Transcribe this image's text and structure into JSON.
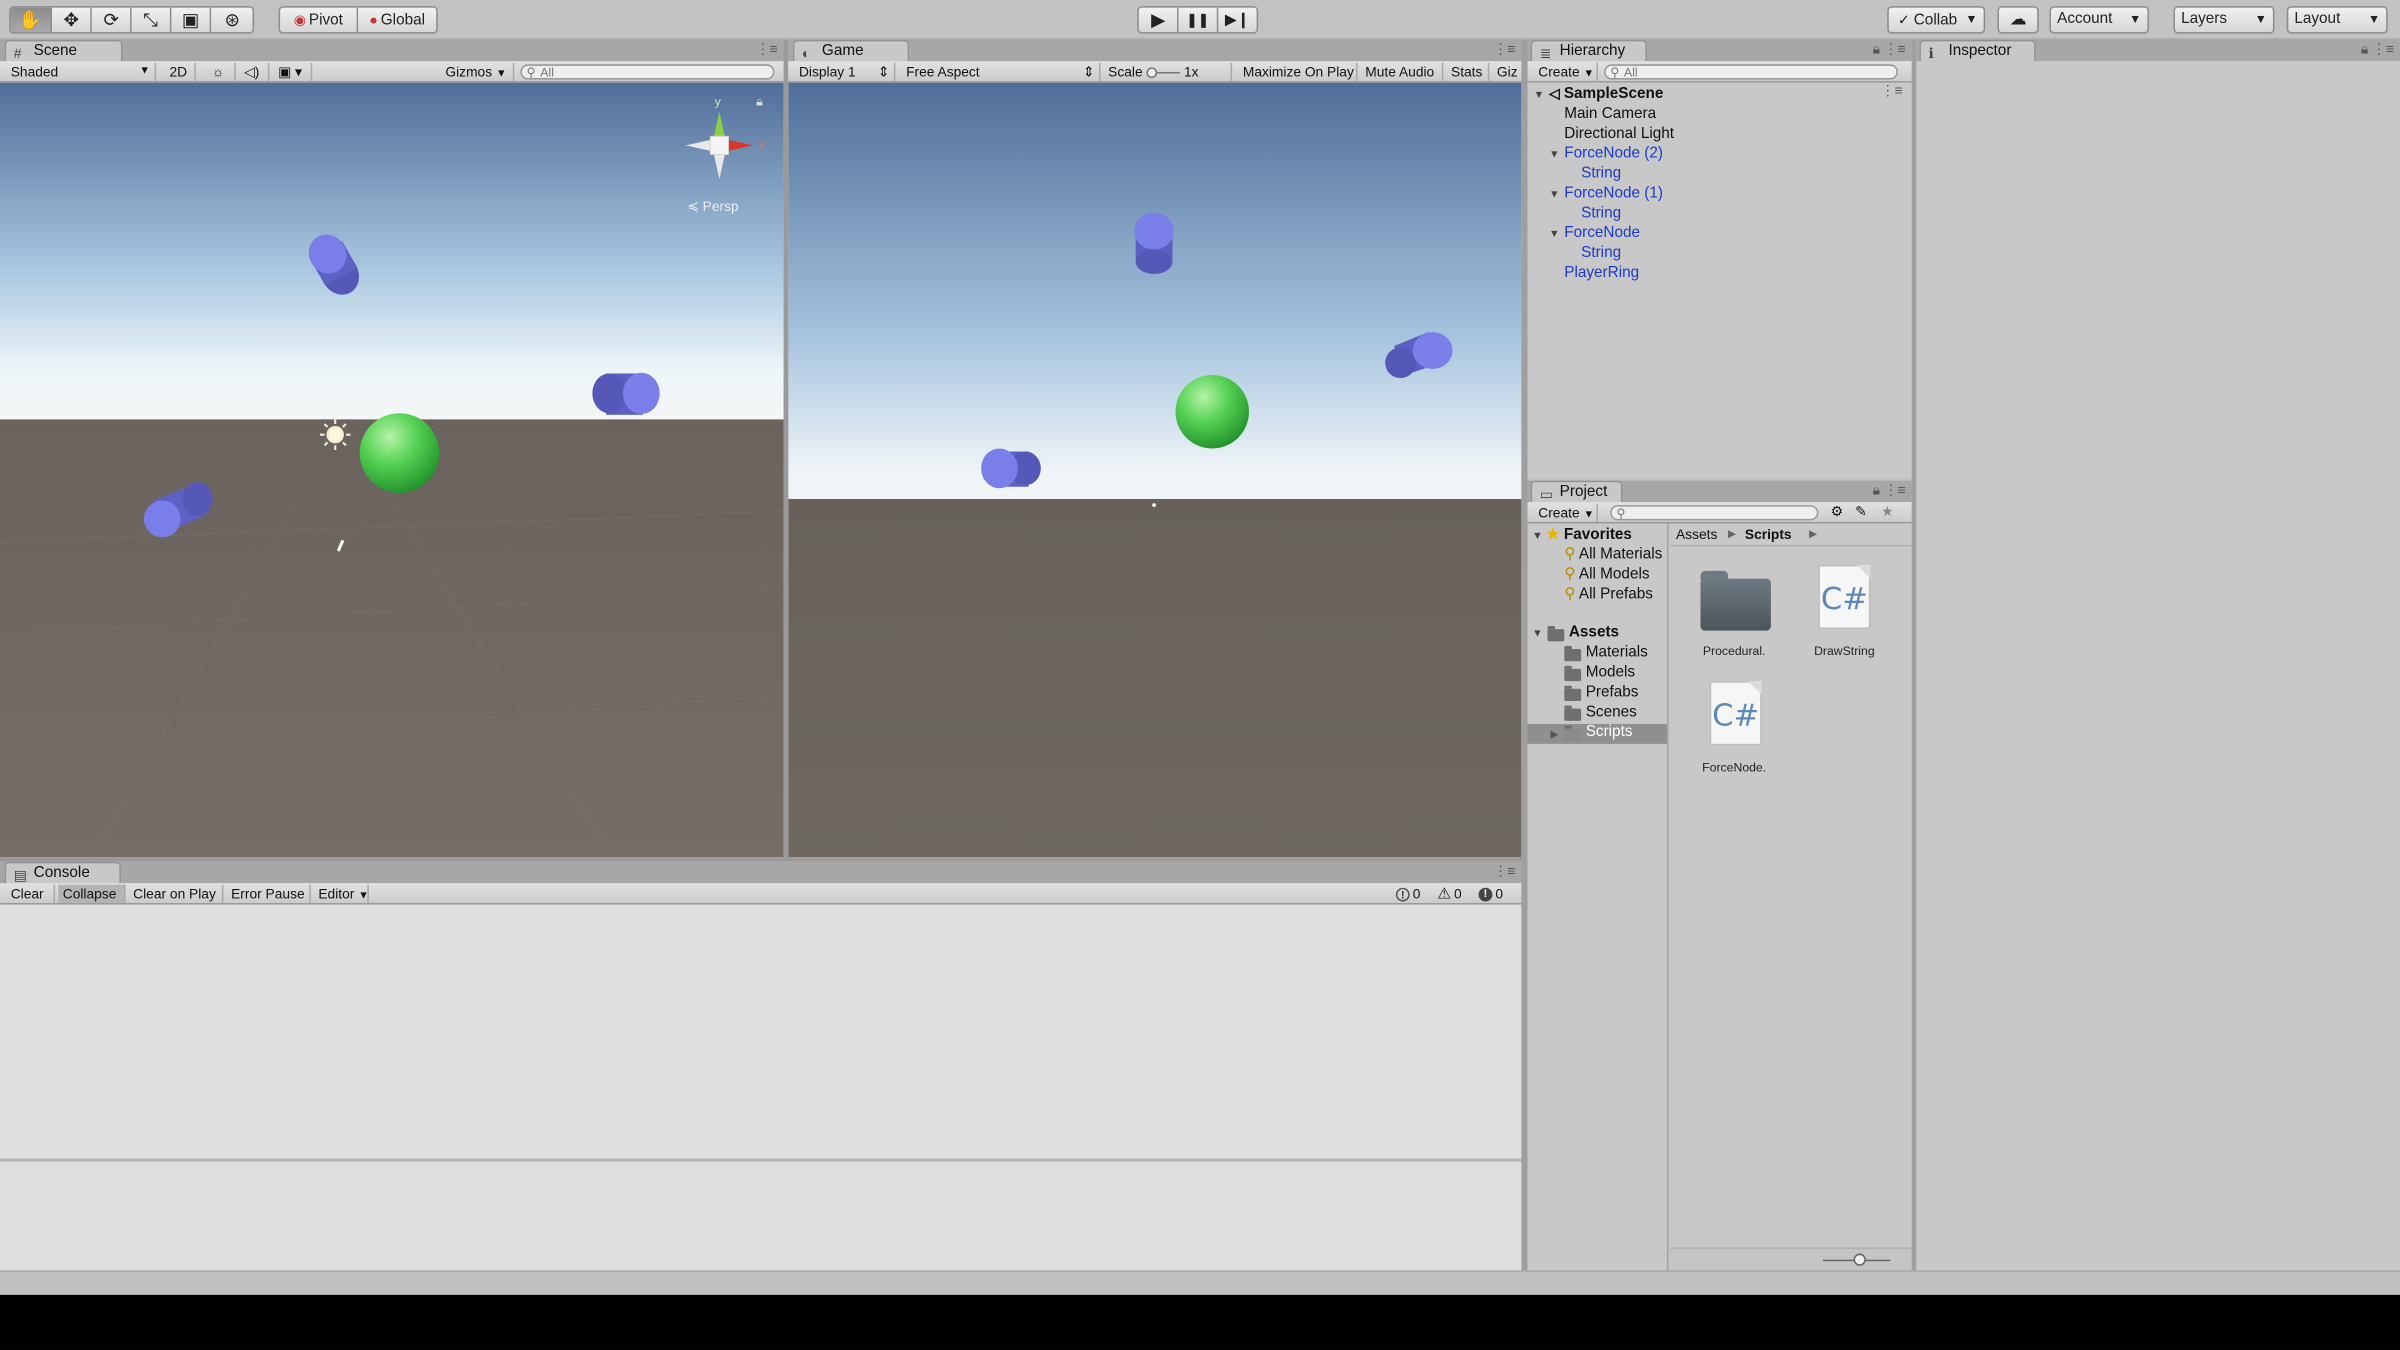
{
  "toolbar": {
    "tools": [
      {
        "icon": "hand-icon",
        "glyph": "✋"
      },
      {
        "icon": "move-icon",
        "glyph": "✥"
      },
      {
        "icon": "rotate-icon",
        "glyph": "⟳"
      },
      {
        "icon": "scale-icon",
        "glyph": "⤡"
      },
      {
        "icon": "rect-tool-icon",
        "glyph": "▣"
      },
      {
        "icon": "transform-tool-icon",
        "glyph": "⊛"
      }
    ],
    "pivot_label": "Pivot",
    "global_label": "Global",
    "play_glyph": "▶",
    "pause_glyph": "❚❚",
    "step_glyph": "▶❙",
    "collab_label": "Collab",
    "account_label": "Account",
    "layers_label": "Layers",
    "layout_label": "Layout"
  },
  "scene": {
    "tab_label": "Scene",
    "shading_mode": "Shaded",
    "mode_2d": "2D",
    "gizmos_label": "Gizmos",
    "search_placeholder": "All",
    "gizmo_axis_y": "y",
    "gizmo_axis_x": "x",
    "persp_label": "Persp"
  },
  "game": {
    "tab_label": "Game",
    "display": "Display 1",
    "aspect": "Free Aspect",
    "scale_label": "Scale",
    "scale_value": "1x",
    "maximize_label": "Maximize On Play",
    "mute_label": "Mute Audio",
    "stats_label": "Stats",
    "gizmos_label": "Giz"
  },
  "hierarchy": {
    "tab_label": "Hierarchy",
    "create_label": "Create",
    "search_placeholder": "All",
    "scene_name": "SampleScene",
    "items": [
      {
        "label": "Main Camera",
        "type": "plain",
        "depth": 1
      },
      {
        "label": "Directional Light",
        "type": "plain",
        "depth": 1
      },
      {
        "label": "ForceNode (2)",
        "type": "prefab",
        "depth": 1,
        "expanded": true
      },
      {
        "label": "String",
        "type": "prefab",
        "depth": 2
      },
      {
        "label": "ForceNode (1)",
        "type": "prefab",
        "depth": 1,
        "expanded": true
      },
      {
        "label": "String",
        "type": "prefab",
        "depth": 2
      },
      {
        "label": "ForceNode",
        "type": "prefab",
        "depth": 1,
        "expanded": true
      },
      {
        "label": "String",
        "type": "prefab",
        "depth": 2
      },
      {
        "label": "PlayerRing",
        "type": "prefab",
        "depth": 1
      }
    ]
  },
  "project": {
    "tab_label": "Project",
    "create_label": "Create",
    "favorites_label": "Favorites",
    "favorites": [
      "All Materials",
      "All Models",
      "All Prefabs"
    ],
    "assets_label": "Assets",
    "folders": [
      "Materials",
      "Models",
      "Prefabs",
      "Scenes",
      "Scripts"
    ],
    "selected_folder": "Scripts",
    "breadcrumb": [
      "Assets",
      "Scripts"
    ],
    "files": [
      {
        "name": "Procedural.",
        "kind": "folder"
      },
      {
        "name": "DrawString",
        "kind": "csharp"
      },
      {
        "name": "ForceNode.",
        "kind": "csharp"
      }
    ],
    "csharp_glyph": "C#"
  },
  "inspector": {
    "tab_label": "Inspector"
  },
  "console": {
    "tab_label": "Console",
    "buttons": [
      "Clear",
      "Collapse",
      "Clear on Play",
      "Error Pause",
      "Editor"
    ],
    "info_count": "0",
    "warning_count": "0",
    "error_count": "0"
  },
  "colors": {
    "editor_bg": "#c2c2c2",
    "prefab_text": "#1a3ac8",
    "cylinder": "#7478e6",
    "sphere": "#5cd85c",
    "ground": "#6f6963"
  }
}
